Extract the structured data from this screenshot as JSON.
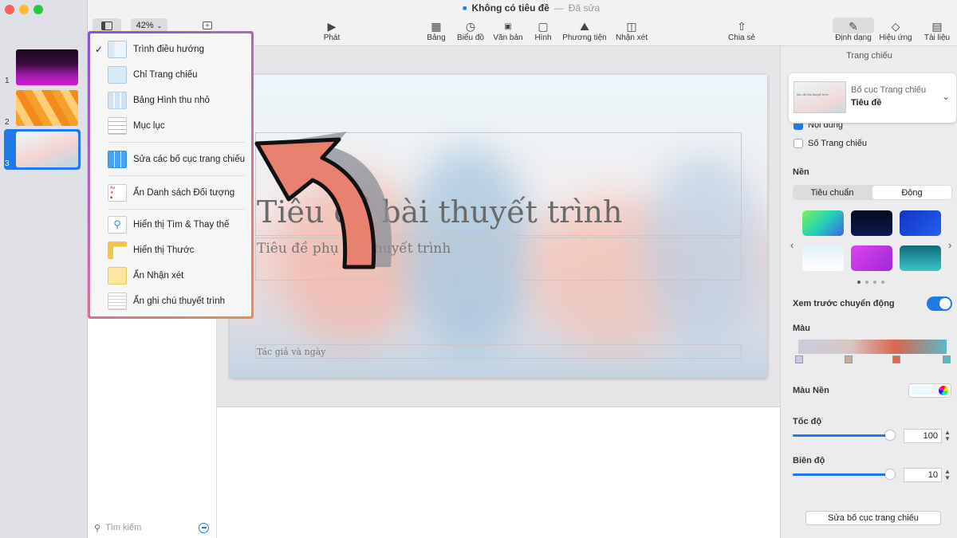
{
  "window": {
    "title": "Không có tiêu đề",
    "title_sep": "—",
    "status": "Đã sửa",
    "traffic_colors": [
      "#fe5f57",
      "#febc2e",
      "#28c840"
    ]
  },
  "toolbar": {
    "zoom": "42%",
    "buttons": [
      {
        "id": "play",
        "label": "Phát",
        "icon": "play-icon"
      },
      {
        "id": "table",
        "label": "Bảng",
        "icon": "table-icon"
      },
      {
        "id": "chart",
        "label": "Biểu đồ",
        "icon": "chart-icon"
      },
      {
        "id": "text",
        "label": "Văn bản",
        "icon": "textbox-icon"
      },
      {
        "id": "shape",
        "label": "Hình",
        "icon": "shape-icon"
      },
      {
        "id": "media",
        "label": "Phương tiện",
        "icon": "media-icon"
      },
      {
        "id": "comment",
        "label": "Nhận xét",
        "icon": "comment-icon"
      },
      {
        "id": "share",
        "label": "Chia sẻ",
        "icon": "share-icon"
      },
      {
        "id": "format",
        "label": "Định dạng",
        "icon": "brush-icon"
      },
      {
        "id": "animate",
        "label": "Hiệu ứng",
        "icon": "diamond-icon"
      },
      {
        "id": "document",
        "label": "Tài liệu",
        "icon": "document-icon"
      }
    ]
  },
  "slides": [
    {
      "num": "1"
    },
    {
      "num": "2"
    },
    {
      "num": "3"
    }
  ],
  "menu": {
    "items": [
      {
        "label": "Trình điều hướng",
        "checked": true,
        "icon": "navigator-icon"
      },
      {
        "label": "Chỉ Trang chiếu",
        "checked": false,
        "icon": "slide-only-icon"
      },
      {
        "label": "Bảng Hình thu nhỏ",
        "checked": false,
        "icon": "light-table-icon"
      },
      {
        "label": "Mục lục",
        "checked": false,
        "icon": "outline-icon"
      },
      {
        "label": "Sửa các bố cục trang chiếu",
        "checked": false,
        "icon": "edit-layouts-icon"
      },
      {
        "label": "Ẩn Danh sách Đối tượng",
        "checked": false,
        "icon": "object-list-icon"
      },
      {
        "label": "Hiển thị Tìm & Thay thế",
        "checked": false,
        "icon": "find-replace-icon"
      },
      {
        "label": "Hiển thị Thước",
        "checked": false,
        "icon": "ruler-icon"
      },
      {
        "label": "Ẩn Nhận xét",
        "checked": false,
        "icon": "comments-icon"
      },
      {
        "label": "Ẩn ghi chú thuyết trình",
        "checked": false,
        "icon": "presenter-notes-icon"
      }
    ]
  },
  "navigator": {
    "search_placeholder": "Tìm kiếm"
  },
  "slide_content": {
    "title": "Tiêu đề bài thuyết trình",
    "subtitle": "Tiêu đề phụ bài thuyết trình",
    "author": "Tác giả và ngày"
  },
  "inspector": {
    "header": "Trang chiếu",
    "layout_label": "Bố cục Trang chiếu",
    "layout_value": "Tiêu đề",
    "layout_thumb_text": "Tiêu đề bài thuyết trình",
    "partial_checkbox": "Nội dung",
    "slide_number": "Số Trang chiếu",
    "background_label": "Nền",
    "tab_standard": "Tiêu chuẩn",
    "tab_dynamic": "Động",
    "preview_motion": "Xem trước chuyển động",
    "color_label": "Màu",
    "bg_color_label": "Màu Nền",
    "speed_label": "Tốc độ",
    "speed_value": "100",
    "amplitude_label": "Biên độ",
    "amplitude_value": "10",
    "edit_layout_button": "Sửa bố cục trang chiếu",
    "swatches": [
      "#2fd59a",
      "#0a1030",
      "#1b4fd8",
      "#e6f5fb",
      "#c83ae0",
      "#1a8aa0"
    ],
    "stop_colors": [
      "#c6cbe3",
      "#c7aaa4",
      "#d8674f",
      "#5bb8c6"
    ],
    "accent": "#1f7ae8"
  }
}
